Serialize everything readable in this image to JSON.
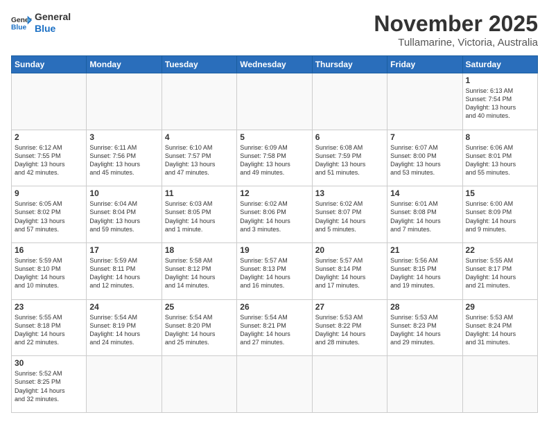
{
  "logo": {
    "line1": "General",
    "line2": "Blue"
  },
  "header": {
    "month": "November 2025",
    "location": "Tullamarine, Victoria, Australia"
  },
  "weekdays": [
    "Sunday",
    "Monday",
    "Tuesday",
    "Wednesday",
    "Thursday",
    "Friday",
    "Saturday"
  ],
  "weeks": [
    [
      {
        "day": "",
        "info": ""
      },
      {
        "day": "",
        "info": ""
      },
      {
        "day": "",
        "info": ""
      },
      {
        "day": "",
        "info": ""
      },
      {
        "day": "",
        "info": ""
      },
      {
        "day": "",
        "info": ""
      },
      {
        "day": "1",
        "info": "Sunrise: 6:13 AM\nSunset: 7:54 PM\nDaylight: 13 hours\nand 40 minutes."
      }
    ],
    [
      {
        "day": "2",
        "info": "Sunrise: 6:12 AM\nSunset: 7:55 PM\nDaylight: 13 hours\nand 42 minutes."
      },
      {
        "day": "3",
        "info": "Sunrise: 6:11 AM\nSunset: 7:56 PM\nDaylight: 13 hours\nand 45 minutes."
      },
      {
        "day": "4",
        "info": "Sunrise: 6:10 AM\nSunset: 7:57 PM\nDaylight: 13 hours\nand 47 minutes."
      },
      {
        "day": "5",
        "info": "Sunrise: 6:09 AM\nSunset: 7:58 PM\nDaylight: 13 hours\nand 49 minutes."
      },
      {
        "day": "6",
        "info": "Sunrise: 6:08 AM\nSunset: 7:59 PM\nDaylight: 13 hours\nand 51 minutes."
      },
      {
        "day": "7",
        "info": "Sunrise: 6:07 AM\nSunset: 8:00 PM\nDaylight: 13 hours\nand 53 minutes."
      },
      {
        "day": "8",
        "info": "Sunrise: 6:06 AM\nSunset: 8:01 PM\nDaylight: 13 hours\nand 55 minutes."
      }
    ],
    [
      {
        "day": "9",
        "info": "Sunrise: 6:05 AM\nSunset: 8:02 PM\nDaylight: 13 hours\nand 57 minutes."
      },
      {
        "day": "10",
        "info": "Sunrise: 6:04 AM\nSunset: 8:04 PM\nDaylight: 13 hours\nand 59 minutes."
      },
      {
        "day": "11",
        "info": "Sunrise: 6:03 AM\nSunset: 8:05 PM\nDaylight: 14 hours\nand 1 minute."
      },
      {
        "day": "12",
        "info": "Sunrise: 6:02 AM\nSunset: 8:06 PM\nDaylight: 14 hours\nand 3 minutes."
      },
      {
        "day": "13",
        "info": "Sunrise: 6:02 AM\nSunset: 8:07 PM\nDaylight: 14 hours\nand 5 minutes."
      },
      {
        "day": "14",
        "info": "Sunrise: 6:01 AM\nSunset: 8:08 PM\nDaylight: 14 hours\nand 7 minutes."
      },
      {
        "day": "15",
        "info": "Sunrise: 6:00 AM\nSunset: 8:09 PM\nDaylight: 14 hours\nand 9 minutes."
      }
    ],
    [
      {
        "day": "16",
        "info": "Sunrise: 5:59 AM\nSunset: 8:10 PM\nDaylight: 14 hours\nand 10 minutes."
      },
      {
        "day": "17",
        "info": "Sunrise: 5:59 AM\nSunset: 8:11 PM\nDaylight: 14 hours\nand 12 minutes."
      },
      {
        "day": "18",
        "info": "Sunrise: 5:58 AM\nSunset: 8:12 PM\nDaylight: 14 hours\nand 14 minutes."
      },
      {
        "day": "19",
        "info": "Sunrise: 5:57 AM\nSunset: 8:13 PM\nDaylight: 14 hours\nand 16 minutes."
      },
      {
        "day": "20",
        "info": "Sunrise: 5:57 AM\nSunset: 8:14 PM\nDaylight: 14 hours\nand 17 minutes."
      },
      {
        "day": "21",
        "info": "Sunrise: 5:56 AM\nSunset: 8:15 PM\nDaylight: 14 hours\nand 19 minutes."
      },
      {
        "day": "22",
        "info": "Sunrise: 5:55 AM\nSunset: 8:17 PM\nDaylight: 14 hours\nand 21 minutes."
      }
    ],
    [
      {
        "day": "23",
        "info": "Sunrise: 5:55 AM\nSunset: 8:18 PM\nDaylight: 14 hours\nand 22 minutes."
      },
      {
        "day": "24",
        "info": "Sunrise: 5:54 AM\nSunset: 8:19 PM\nDaylight: 14 hours\nand 24 minutes."
      },
      {
        "day": "25",
        "info": "Sunrise: 5:54 AM\nSunset: 8:20 PM\nDaylight: 14 hours\nand 25 minutes."
      },
      {
        "day": "26",
        "info": "Sunrise: 5:54 AM\nSunset: 8:21 PM\nDaylight: 14 hours\nand 27 minutes."
      },
      {
        "day": "27",
        "info": "Sunrise: 5:53 AM\nSunset: 8:22 PM\nDaylight: 14 hours\nand 28 minutes."
      },
      {
        "day": "28",
        "info": "Sunrise: 5:53 AM\nSunset: 8:23 PM\nDaylight: 14 hours\nand 29 minutes."
      },
      {
        "day": "29",
        "info": "Sunrise: 5:53 AM\nSunset: 8:24 PM\nDaylight: 14 hours\nand 31 minutes."
      }
    ],
    [
      {
        "day": "30",
        "info": "Sunrise: 5:52 AM\nSunset: 8:25 PM\nDaylight: 14 hours\nand 32 minutes."
      },
      {
        "day": "",
        "info": ""
      },
      {
        "day": "",
        "info": ""
      },
      {
        "day": "",
        "info": ""
      },
      {
        "day": "",
        "info": ""
      },
      {
        "day": "",
        "info": ""
      },
      {
        "day": "",
        "info": ""
      }
    ]
  ]
}
